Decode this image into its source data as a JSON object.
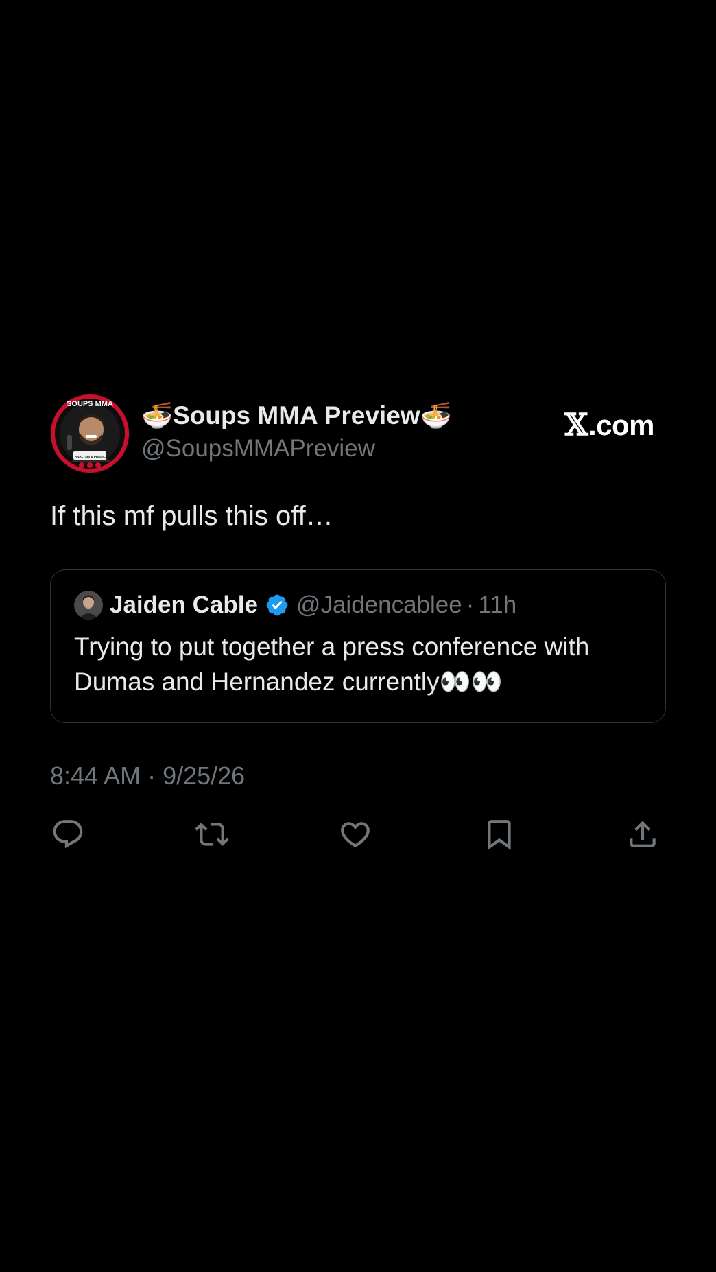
{
  "tweet": {
    "display_name": "🍜Soups MMA Preview🍜",
    "handle": "@SoupsMMAPreview",
    "text": "If this mf pulls this off…",
    "timestamp": "8:44 AM · 9/25/26",
    "avatar_text": "SOUPS MMA",
    "avatar_subtext": "FIGHT ANALYSIS & PREDICTIONS"
  },
  "brand": {
    "x": "𝕏",
    "suffix": ".com"
  },
  "quote": {
    "name": "Jaiden Cable",
    "handle": "@Jaidencablee",
    "separator": "·",
    "time": "11h",
    "text": "Trying to put together a press conference with Dumas and Hernandez currently👀👀"
  },
  "actions": [
    {
      "icon": "reply-icon"
    },
    {
      "icon": "repost-icon"
    },
    {
      "icon": "like-icon"
    },
    {
      "icon": "bookmark-icon"
    },
    {
      "icon": "share-icon"
    }
  ],
  "colors": {
    "background": "#000000",
    "text_primary": "#e7e9ea",
    "text_secondary": "#71767b",
    "border": "#2f3336",
    "verified": "#1d9bf0",
    "avatar_red": "#c8102e"
  }
}
